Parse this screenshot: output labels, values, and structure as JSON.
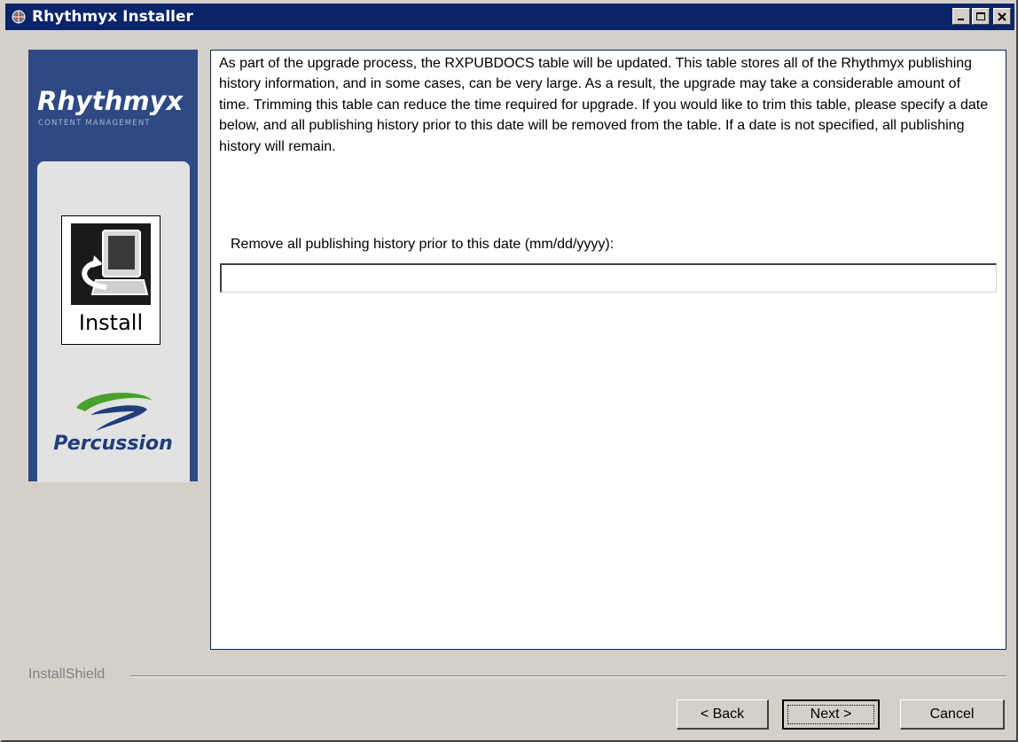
{
  "window": {
    "title": "Rhythmyx Installer",
    "controls": [
      "minimize-icon",
      "maximize-icon",
      "close-icon"
    ]
  },
  "sidebar": {
    "brand": "Rhythmyx",
    "brand_subtitle": "CONTENT MANAGEMENT",
    "install_label": "Install",
    "company": "Percussion"
  },
  "content": {
    "description": "As part of the upgrade process, the RXPUBDOCS table will be updated.  This table stores all of the Rhythmyx publishing history information, and in some cases, can be very large.  As a result, the upgrade may take a considerable amount of time.  Trimming this table can reduce the time required for upgrade.  If you would like to trim this table, please specify a date below, and all publishing history prior to this date will be removed from the table.  If a date is not specified, all publishing history will remain.",
    "date_label": "Remove all publishing history prior to this date (mm/dd/yyyy):",
    "date_value": ""
  },
  "footer": {
    "installshield": "InstallShield",
    "back_label": "< Back",
    "next_label": "Next >",
    "cancel_label": "Cancel"
  },
  "colors": {
    "titlebar": "#0a246a",
    "sidebar": "#2e4a84",
    "window_bg": "#d4d0c8",
    "percussion_swoosh": "#4aa02c"
  }
}
